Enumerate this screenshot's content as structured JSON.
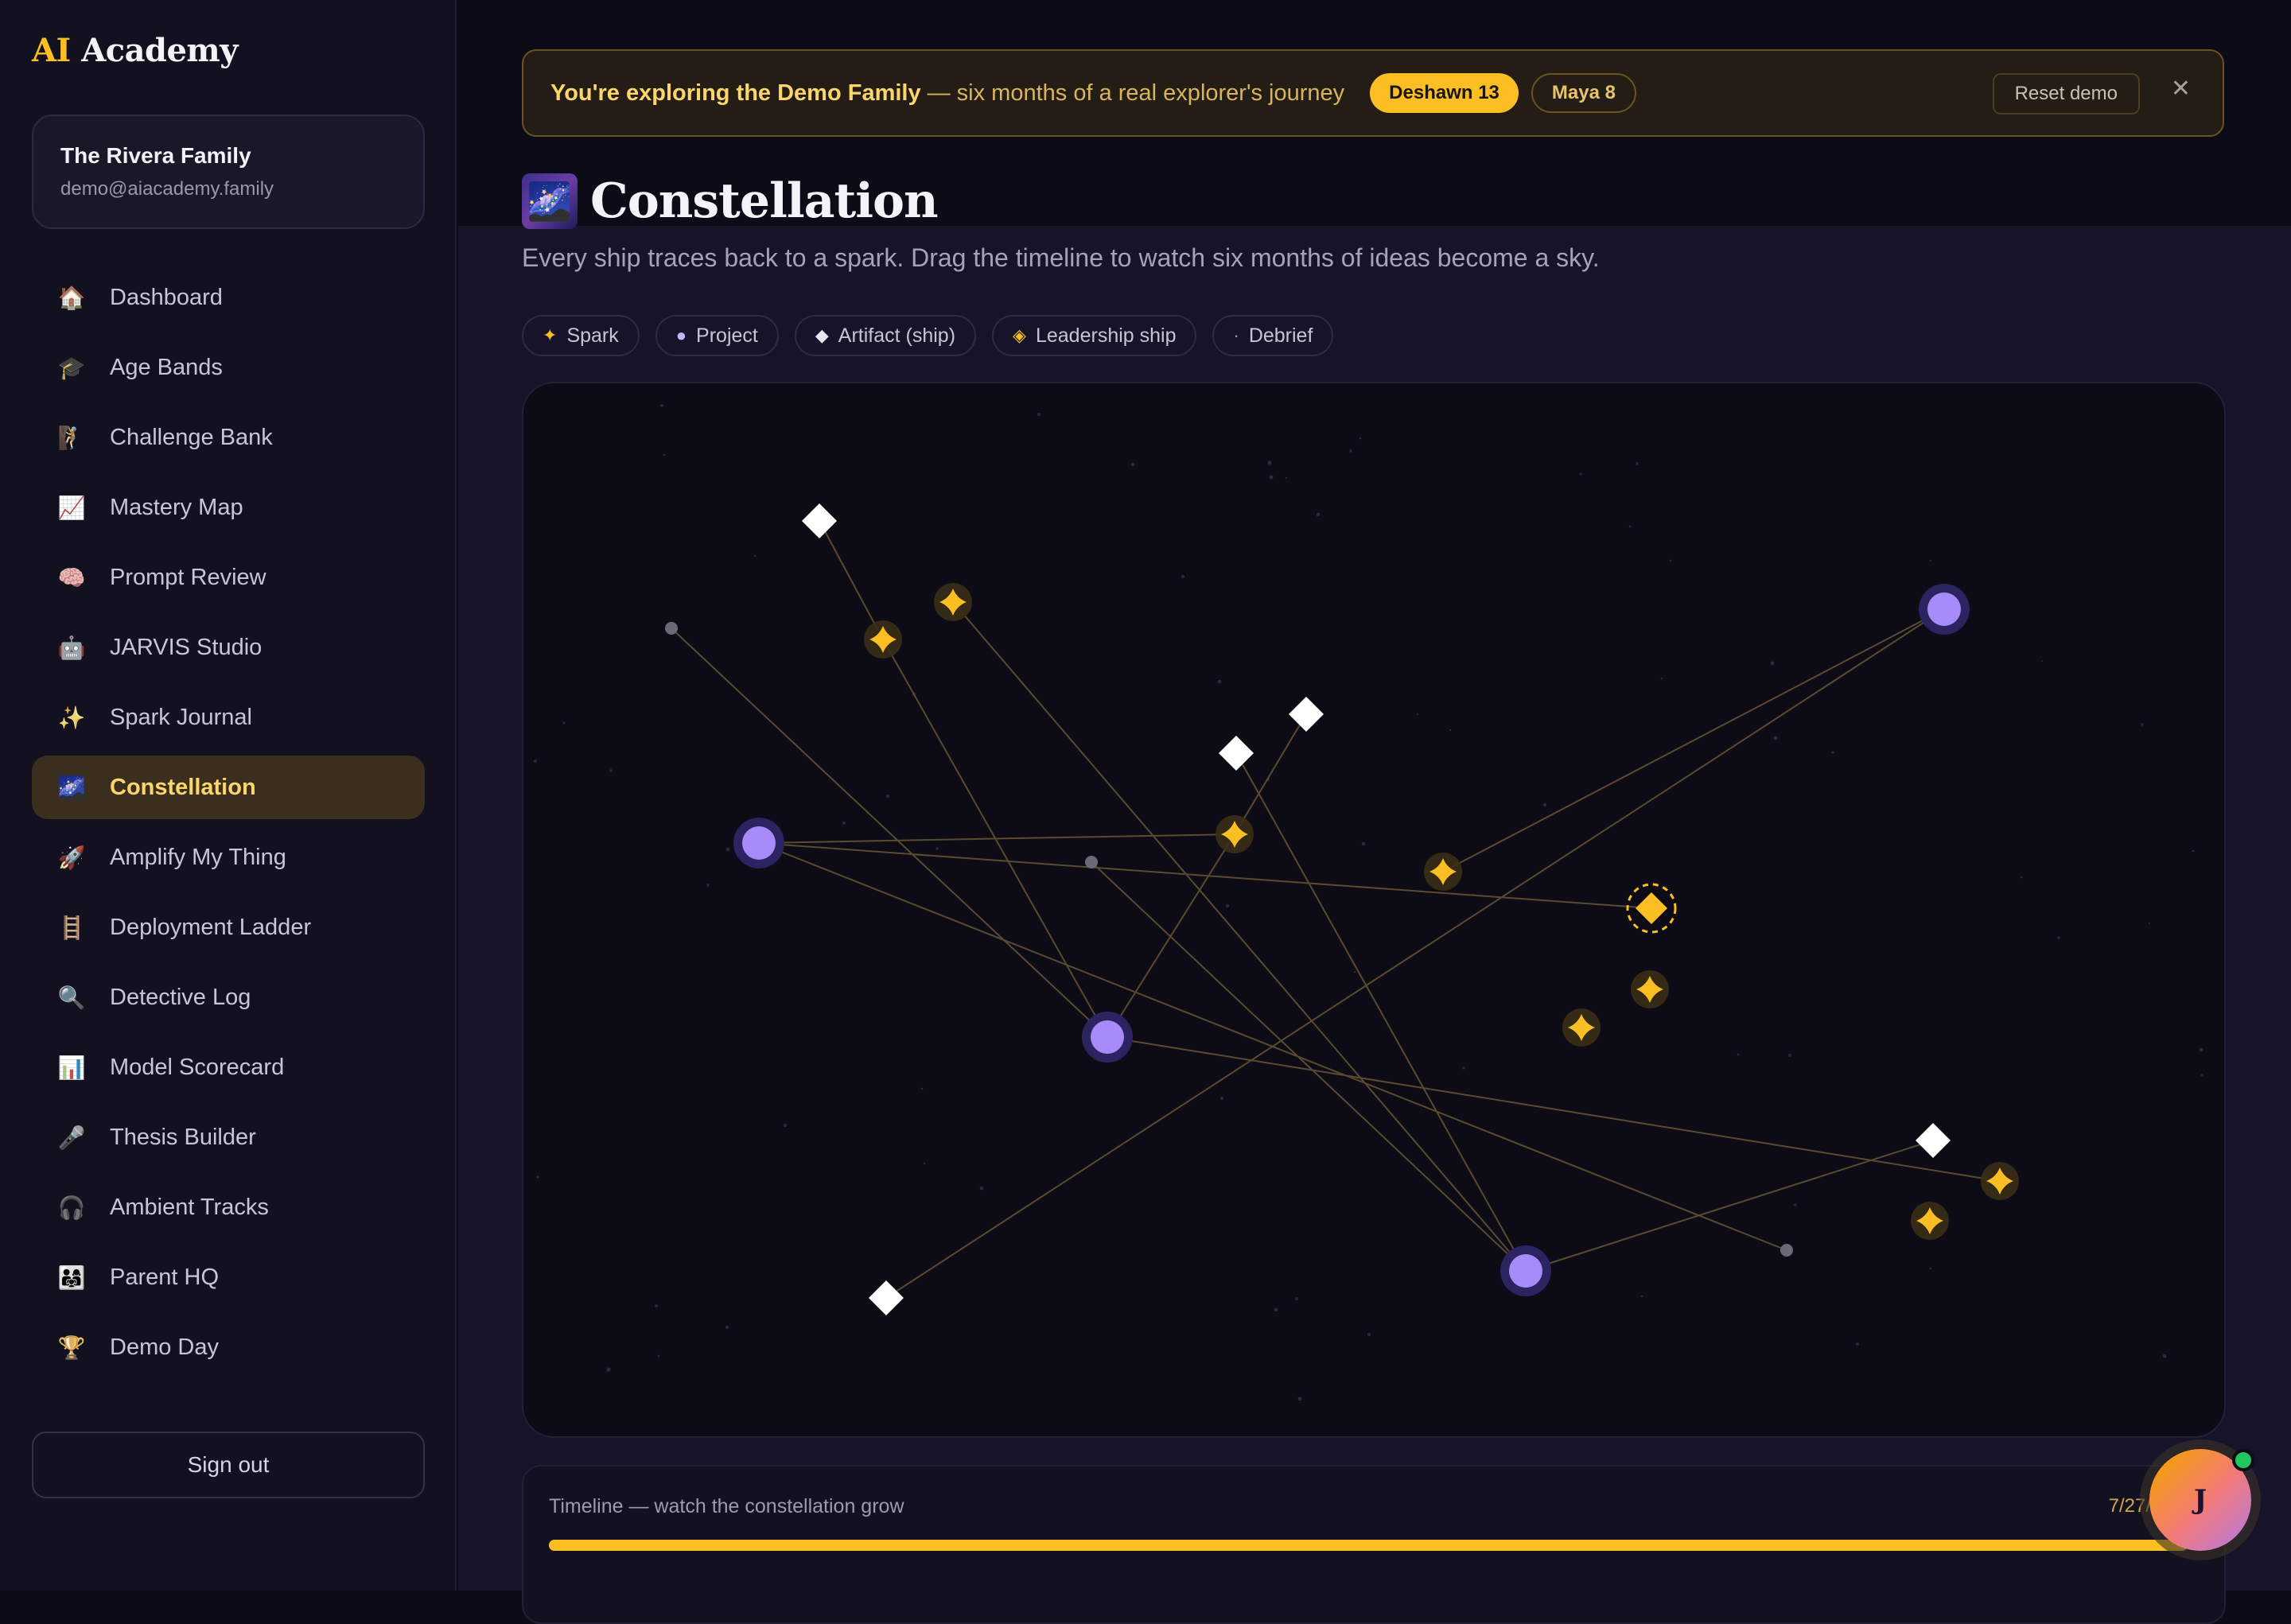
{
  "brand": {
    "accent": "AI",
    "name": "Academy"
  },
  "account": {
    "family": "The Rivera Family",
    "email": "demo@aiacademy.family"
  },
  "nav": [
    {
      "label": "Dashboard",
      "icon": "🏠",
      "name": "house-icon"
    },
    {
      "label": "Age Bands",
      "icon": "🎓",
      "name": "graduation-cap-icon"
    },
    {
      "label": "Challenge Bank",
      "icon": "🧗",
      "name": "climber-icon"
    },
    {
      "label": "Mastery Map",
      "icon": "📈",
      "name": "chart-up-icon"
    },
    {
      "label": "Prompt Review",
      "icon": "🧠",
      "name": "brain-icon"
    },
    {
      "label": "JARVIS Studio",
      "icon": "🤖",
      "name": "robot-icon"
    },
    {
      "label": "Spark Journal",
      "icon": "✨",
      "name": "sparkles-icon"
    },
    {
      "label": "Constellation",
      "icon": "🌌",
      "name": "milky-way-icon",
      "active": true
    },
    {
      "label": "Amplify My Thing",
      "icon": "🚀",
      "name": "rocket-icon"
    },
    {
      "label": "Deployment Ladder",
      "icon": "🪜",
      "name": "ladder-icon"
    },
    {
      "label": "Detective Log",
      "icon": "🔍",
      "name": "magnifier-icon"
    },
    {
      "label": "Model Scorecard",
      "icon": "📊",
      "name": "bar-chart-icon"
    },
    {
      "label": "Thesis Builder",
      "icon": "🎤",
      "name": "microphone-icon"
    },
    {
      "label": "Ambient Tracks",
      "icon": "🎧",
      "name": "headphones-icon"
    },
    {
      "label": "Parent HQ",
      "icon": "👨‍👩‍👧",
      "name": "family-icon"
    },
    {
      "label": "Demo Day",
      "icon": "🏆",
      "name": "trophy-icon"
    }
  ],
  "signout": "Sign out",
  "banner": {
    "lead": "You're exploring the Demo Family",
    "rest": "— six months of a real explorer's journey",
    "kids": [
      {
        "label": "Deshawn 13",
        "active": true
      },
      {
        "label": "Maya 8",
        "active": false
      }
    ],
    "reset": "Reset demo",
    "close": "✕"
  },
  "page": {
    "icon": "🌌",
    "title": "Constellation",
    "subtitle": "Every ship traces back to a spark. Drag the timeline to watch six months of ideas become a sky."
  },
  "legend": [
    {
      "sym": "✦",
      "label": "Spark",
      "color": "#fbbf24"
    },
    {
      "sym": "●",
      "label": "Project",
      "color": "#c4b5fd"
    },
    {
      "sym": "◆",
      "label": "Artifact (ship)",
      "color": "#e8e6f0"
    },
    {
      "sym": "◈",
      "label": "Leadership ship",
      "color": "#fbbf24"
    },
    {
      "sym": "·",
      "label": "Debrief",
      "color": "#9ca3af"
    }
  ],
  "timeline": {
    "label": "Timeline — watch the constellation grow",
    "date": "7/27/",
    "progress": 1.0
  },
  "avatar": {
    "initial": "J"
  },
  "colors": {
    "spark": "#fbbf24",
    "project": "#a78bfa",
    "artifact": "#ffffff",
    "debrief": "#6b6b78",
    "link": "#5b4a2e"
  }
}
